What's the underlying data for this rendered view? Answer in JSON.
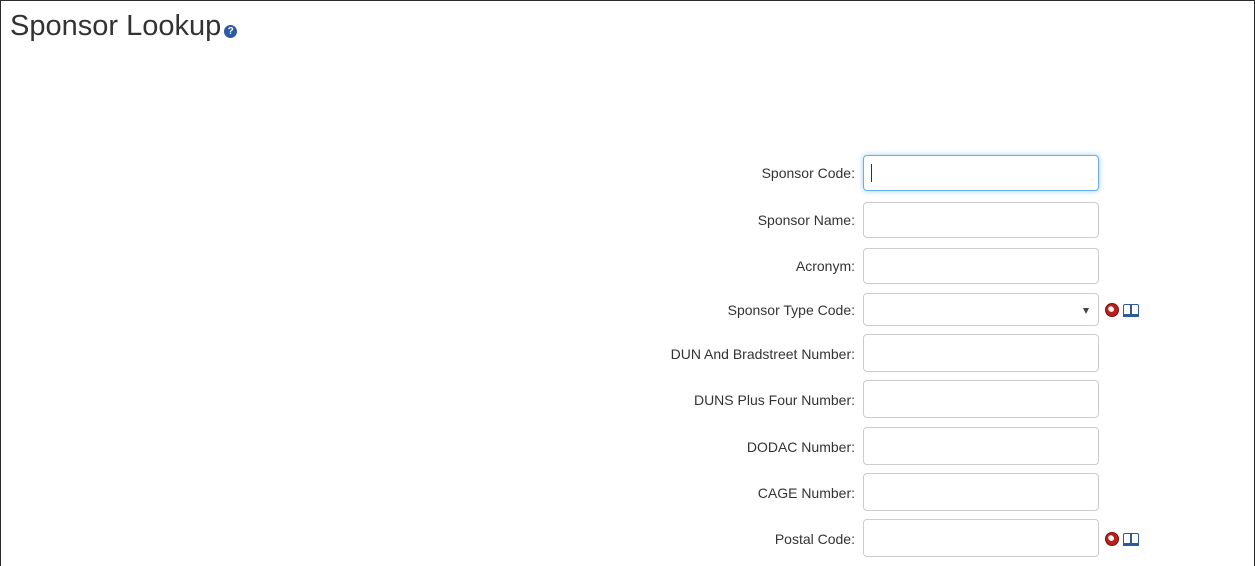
{
  "page": {
    "title": "Sponsor Lookup",
    "help_glyph": "?"
  },
  "form": {
    "fields": [
      {
        "label": "Sponsor Code:",
        "value": "",
        "type": "text",
        "focused": true
      },
      {
        "label": "Sponsor Name:",
        "value": "",
        "type": "text"
      },
      {
        "label": "Acronym:",
        "value": "",
        "type": "text"
      },
      {
        "label": "Sponsor Type Code:",
        "value": "",
        "type": "select",
        "icons": [
          "lookup-icon",
          "book-icon"
        ]
      },
      {
        "label": "DUN And Bradstreet Number:",
        "value": "",
        "type": "text"
      },
      {
        "label": "DUNS Plus Four Number:",
        "value": "",
        "type": "text"
      },
      {
        "label": "DODAC Number:",
        "value": "",
        "type": "text"
      },
      {
        "label": "CAGE Number:",
        "value": "",
        "type": "text"
      },
      {
        "label": "Postal Code:",
        "value": "",
        "type": "text",
        "icons": [
          "lookup-icon",
          "book-icon"
        ]
      }
    ]
  },
  "colors": {
    "text": "#333333",
    "help_icon": "#2b5aa7",
    "focus_border": "#66afe9",
    "input_border": "#cccccc"
  }
}
